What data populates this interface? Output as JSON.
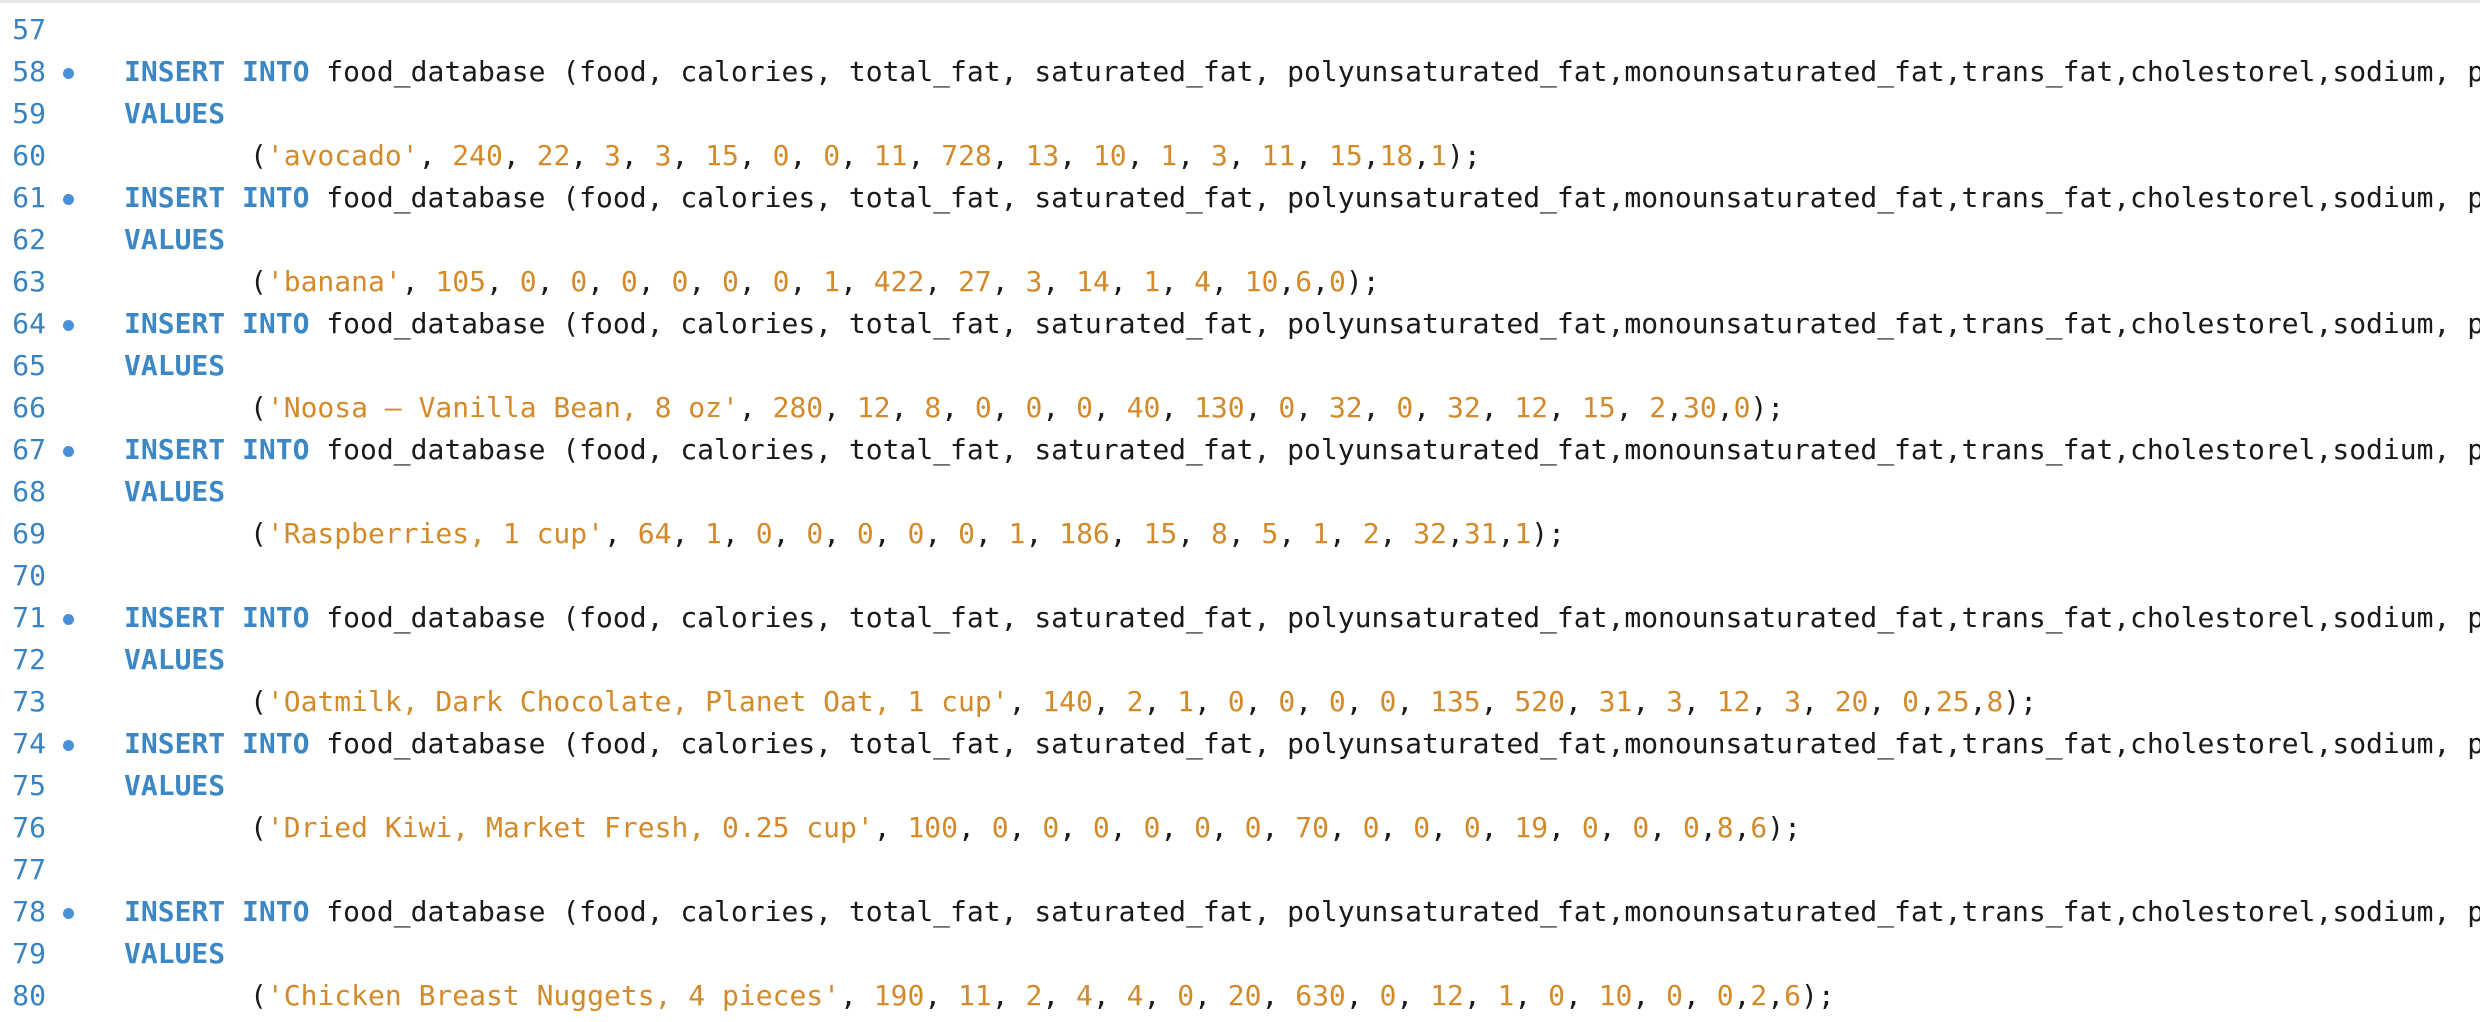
{
  "editor": {
    "line_numbers": [
      "57",
      "58",
      "59",
      "60",
      "61",
      "62",
      "63",
      "64",
      "65",
      "66",
      "67",
      "68",
      "69",
      "70",
      "71",
      "72",
      "73",
      "74",
      "75",
      "76",
      "77",
      "78",
      "79",
      "80"
    ],
    "insert_kw": "INSERT",
    "into_kw": "INTO",
    "values_kw": "VALUES",
    "insert_tail": " food_database (food, calories, total_fat, saturated_fat, polyunsaturated_fat,monounsaturated_fat,trans_fat,cholestorel,sodium, potassium,to",
    "statements": [
      {
        "open": "(",
        "food": "'avocado'",
        "rest": ", 240, 22, 3, 3, 15, 0, 0, 11, 728, 13, 10, 1, 3, 11, 15,18,1",
        "close": ");"
      },
      {
        "open": "(",
        "food": "'banana'",
        "rest": ", 105, 0, 0, 0, 0, 0, 0, 1, 422, 27, 3, 14, 1, 4, 10,6,0",
        "close": ");"
      },
      {
        "open": "(",
        "food": "'Noosa – Vanilla Bean, 8 oz'",
        "rest": ", 280, 12, 8, 0, 0, 0, 40, 130, 0, 32, 0, 32, 12, 15, 2,30,0",
        "close": ");"
      },
      {
        "open": "(",
        "food": "'Raspberries, 1 cup'",
        "rest": ", 64, 1, 0, 0, 0, 0, 0, 1, 186, 15, 8, 5, 1, 2, 32,31,1",
        "close": ");"
      },
      {
        "open": "(",
        "food": "'Oatmilk, Dark Chocolate, Planet Oat, 1 cup'",
        "rest": ", 140, 2, 1, 0, 0, 0, 0, 135, 520, 31, 3, 12, 3, 20, 0,25,8",
        "close": ");"
      },
      {
        "open": "(",
        "food": "'Dried Kiwi, Market Fresh, 0.25 cup'",
        "rest": ", 100, 0, 0, 0, 0, 0, 0, 70, 0, 0, 0, 19, 0, 0, 0,8,6",
        "close": ");"
      },
      {
        "open": "(",
        "food": "'Chicken Breast Nuggets, 4 pieces'",
        "rest": ", 190, 11, 2, 4, 4, 0, 20, 630, 0, 12, 1, 0, 10, 0, 0,2,6",
        "close": ");"
      }
    ]
  },
  "colors": {
    "keyword": "#3d88c4",
    "string": "#d28a2b",
    "number": "#d28a2b",
    "line_number": "#3b83bf",
    "marker": "#4a90d9"
  }
}
